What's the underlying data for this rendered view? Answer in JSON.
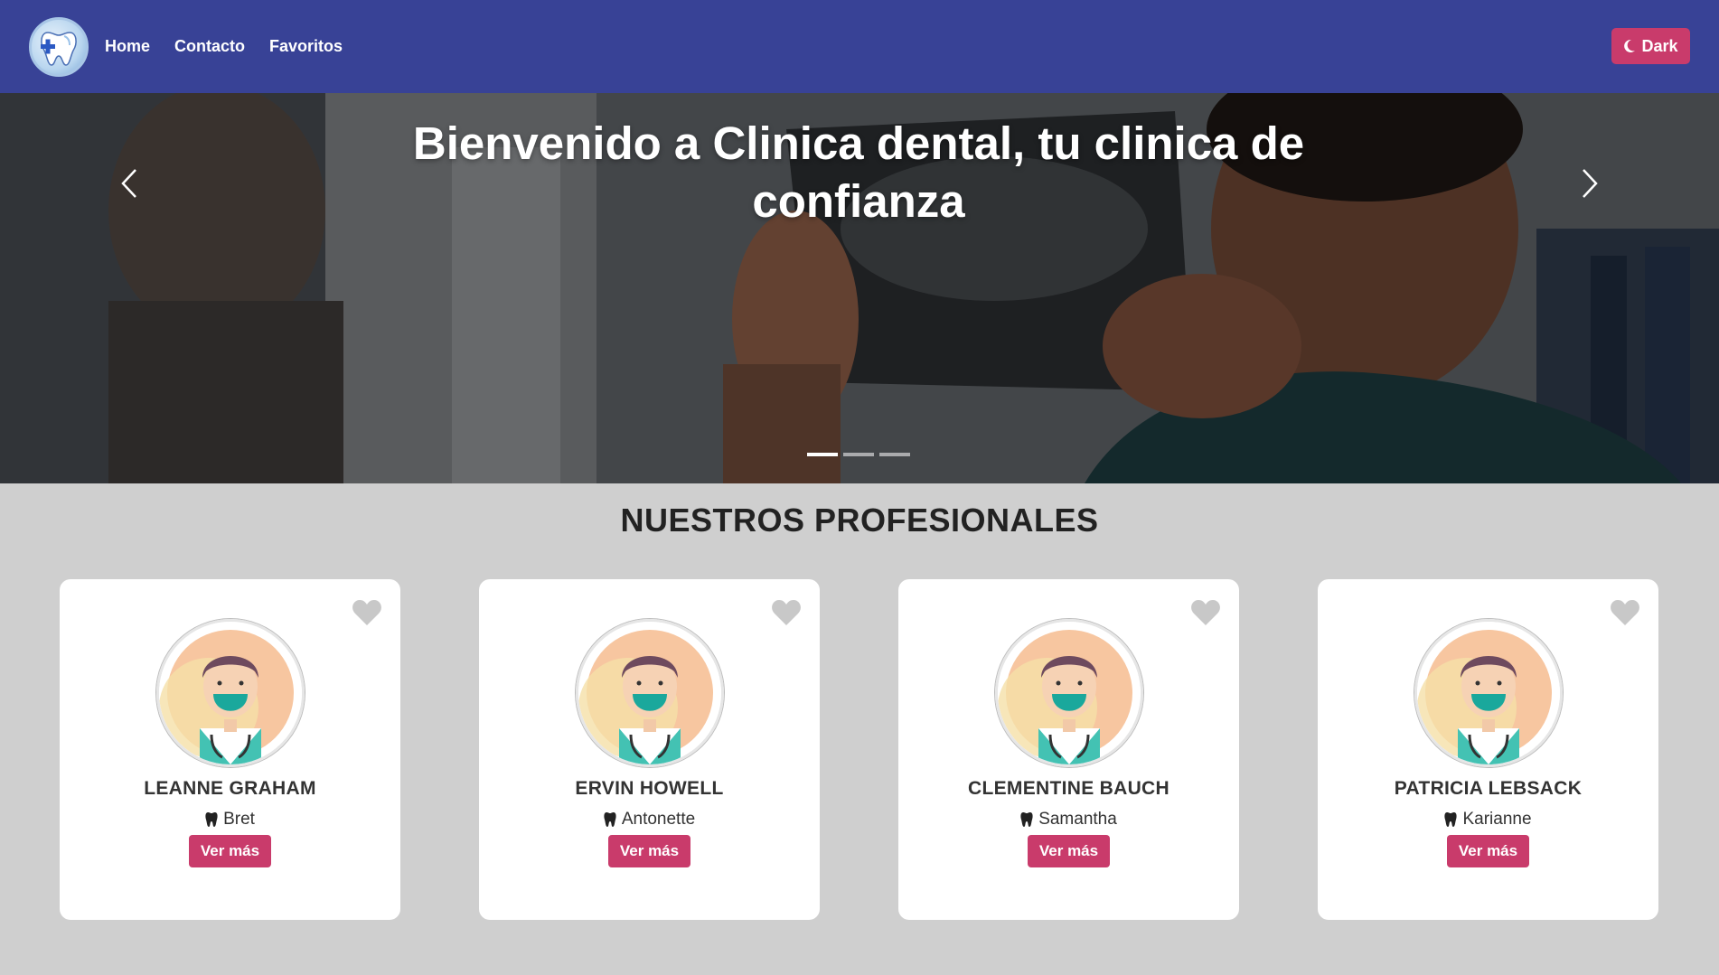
{
  "nav": {
    "links": [
      "Home",
      "Contacto",
      "Favoritos"
    ],
    "dark_label": "Dark"
  },
  "hero": {
    "title": "Bienvenido a Clinica dental, tu clinica de confianza",
    "slide_count": 3,
    "active_slide": 0
  },
  "section": {
    "title": "NUESTROS PROFESIONALES"
  },
  "dentists": [
    {
      "name": "LEANNE GRAHAM",
      "username": "Bret",
      "button": "Ver más"
    },
    {
      "name": "ERVIN HOWELL",
      "username": "Antonette",
      "button": "Ver más"
    },
    {
      "name": "CLEMENTINE BAUCH",
      "username": "Samantha",
      "button": "Ver más"
    },
    {
      "name": "PATRICIA LEBSACK",
      "username": "Karianne",
      "button": "Ver más"
    }
  ],
  "colors": {
    "navbar": "#384296",
    "accent": "#c93b6b",
    "page_background": "#cfcfcf"
  },
  "icons": {
    "dark_button": "moon-icon",
    "username": "tooth-icon",
    "favorite": "heart-icon"
  }
}
